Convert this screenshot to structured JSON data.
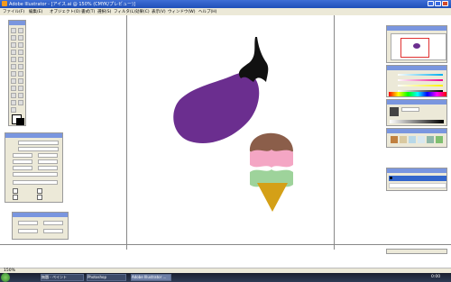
{
  "window": {
    "title": "Adobe Illustrator - [アイス.ai @ 150% (CMYK/プレビュー)]"
  },
  "menu": {
    "items": [
      "ファイル(F)",
      "編集(E)",
      "オブジェクト(O)",
      "書式(T)",
      "選択(S)",
      "フィルタ(L)",
      "効果(C)",
      "表示(V)",
      "ウィンドウ(W)",
      "ヘルプ(H)"
    ]
  },
  "status": {
    "zoom": "150%"
  },
  "taskbar": {
    "items": [
      "無題 - ペイント",
      "Photoshop",
      "Adobe Illustrator ..."
    ],
    "clock": "0:00"
  },
  "colors": {
    "eggplant": "#6b2e8f",
    "stem": "#111111",
    "scoop_chocolate": "#8b5e4a",
    "scoop_strawberry": "#f4a6c4",
    "scoop_mint": "#9ed39b",
    "cone": "#d4a017"
  }
}
